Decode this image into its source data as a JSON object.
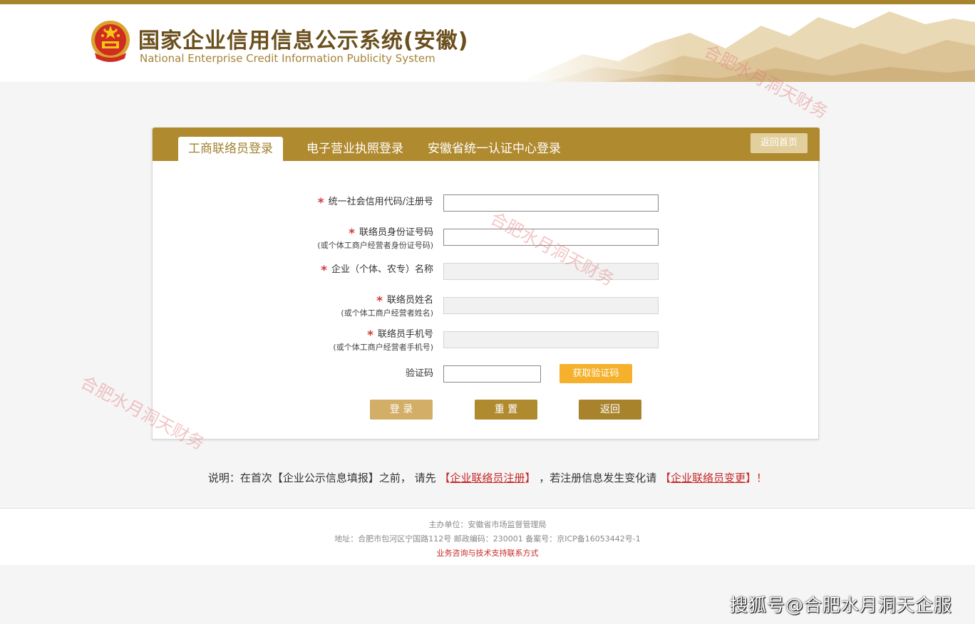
{
  "header": {
    "title_cn": "国家企业信用信息公示系统(安徽)",
    "title_en": "National Enterprise Credit Information Publicity System"
  },
  "tabs": [
    {
      "label": "工商联络员登录",
      "active": true
    },
    {
      "label": "电子营业执照登录",
      "active": false
    },
    {
      "label": "安徽省统一认证中心登录",
      "active": false
    }
  ],
  "home_button": "返回首页",
  "form": {
    "credit_code": {
      "label": "统一社会信用代码/注册号",
      "value": ""
    },
    "id_number": {
      "label": "联络员身份证号码",
      "sub": "(或个体工商户经营者身份证号码)",
      "value": ""
    },
    "company_name": {
      "label": "企业（个体、农专）名称",
      "value": ""
    },
    "contact_name": {
      "label": "联络员姓名",
      "sub": "(或个体工商户经营者姓名)",
      "value": ""
    },
    "phone": {
      "label": "联络员手机号",
      "sub": "(或个体工商户经营者手机号)",
      "value": ""
    },
    "captcha": {
      "label": "验证码",
      "value": ""
    },
    "sms_button": "获取验证码",
    "login_button": "登 录",
    "reset_button": "重 置",
    "back_button": "返回"
  },
  "notice": {
    "prefix": "说明：在首次【企业公示信息填报】之前， 请先",
    "register_link": "企业联络员注册",
    "middle": "，若注册信息发生变化请",
    "change_link": "企业联络员变更",
    "suffix": "！"
  },
  "footer": {
    "host": "主办单位：安徽省市场监督管理局",
    "address": "地址：合肥市包河区宁国路112号 邮政编码：230001 备案号：京ICP备16053442号-1",
    "support_link": "业务咨询与技术支持联系方式"
  },
  "watermark": "合肥水月洞天财务",
  "sohu_mark": "搜狐号@合肥水月洞天企服",
  "colors": {
    "brand": "#b08a2f",
    "accent": "#f5b12b",
    "link": "#c62828"
  }
}
